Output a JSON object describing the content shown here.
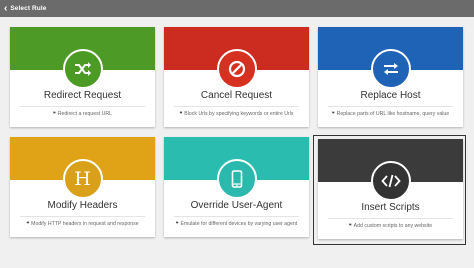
{
  "topbar": {
    "back_icon": "chevron-left-icon",
    "title": "Select Rule"
  },
  "cards": [
    {
      "title": "Redirect Request",
      "description": "Redirect a request URL",
      "icon": "shuffle-icon",
      "color": "#4e9a26",
      "circle_color": "#4a9a24"
    },
    {
      "title": "Cancel Request",
      "description": "Block Urls by specifying keywords or entire Urls",
      "icon": "block-icon",
      "color": "#cc2c1f",
      "circle_color": "#d63020"
    },
    {
      "title": "Replace Host",
      "description": "Replace parts of URL like hostname, query value",
      "icon": "swap-arrows-icon",
      "color": "#1f63b7",
      "circle_color": "#1f63b7"
    },
    {
      "title": "Modify Headers",
      "description": "Modify HTTP headers in request and response",
      "icon": "letter-h-icon",
      "icon_text": "H",
      "color": "#e0a318",
      "circle_color": "#d9a11a"
    },
    {
      "title": "Override User-Agent",
      "description": "Emulate for different devices by varying user agent",
      "icon": "mobile-device-icon",
      "color": "#2bbcb0",
      "circle_color": "#2bb9ad"
    },
    {
      "title": "Insert Scripts",
      "description": "Add custom scripts to any website",
      "icon": "code-icon",
      "color": "#3b3b3b",
      "circle_color": "#333333"
    }
  ]
}
